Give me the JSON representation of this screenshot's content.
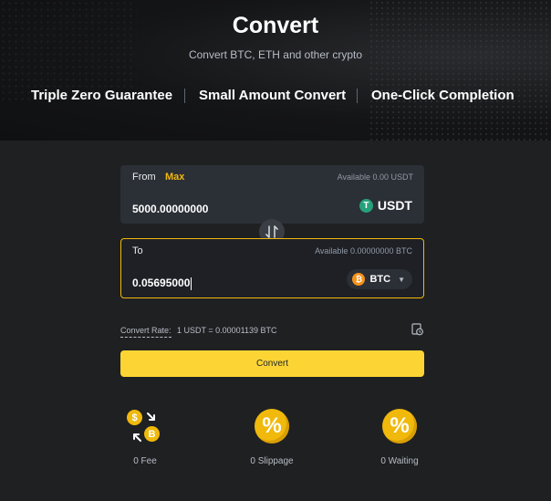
{
  "hero": {
    "title": "Convert",
    "subtitle": "Convert BTC, ETH and other crypto",
    "features": [
      "Triple Zero Guarantee",
      "Small Amount Convert",
      "One-Click Completion"
    ]
  },
  "from": {
    "label": "From",
    "max_label": "Max",
    "available": "Available 0.00 USDT",
    "amount": "5000.00000000",
    "coin": "USDT"
  },
  "to": {
    "label": "To",
    "available": "Available 0.00000000 BTC",
    "amount": "0.05695000",
    "coin": "BTC"
  },
  "rate": {
    "label": "Convert Rate:",
    "value": "1 USDT = 0.00001139 BTC"
  },
  "convert_button": "Convert",
  "perks": [
    {
      "label": "0 Fee",
      "icon": "coin-exchange-icon"
    },
    {
      "label": "0 Slippage",
      "icon": "percent-icon"
    },
    {
      "label": "0 Waiting",
      "icon": "percent-icon"
    }
  ],
  "colors": {
    "accent": "#f0b90b",
    "button": "#fcd535",
    "tether": "#26a17b",
    "bitcoin": "#f7931a",
    "background": "#1f2022",
    "card": "#2b2f36"
  }
}
